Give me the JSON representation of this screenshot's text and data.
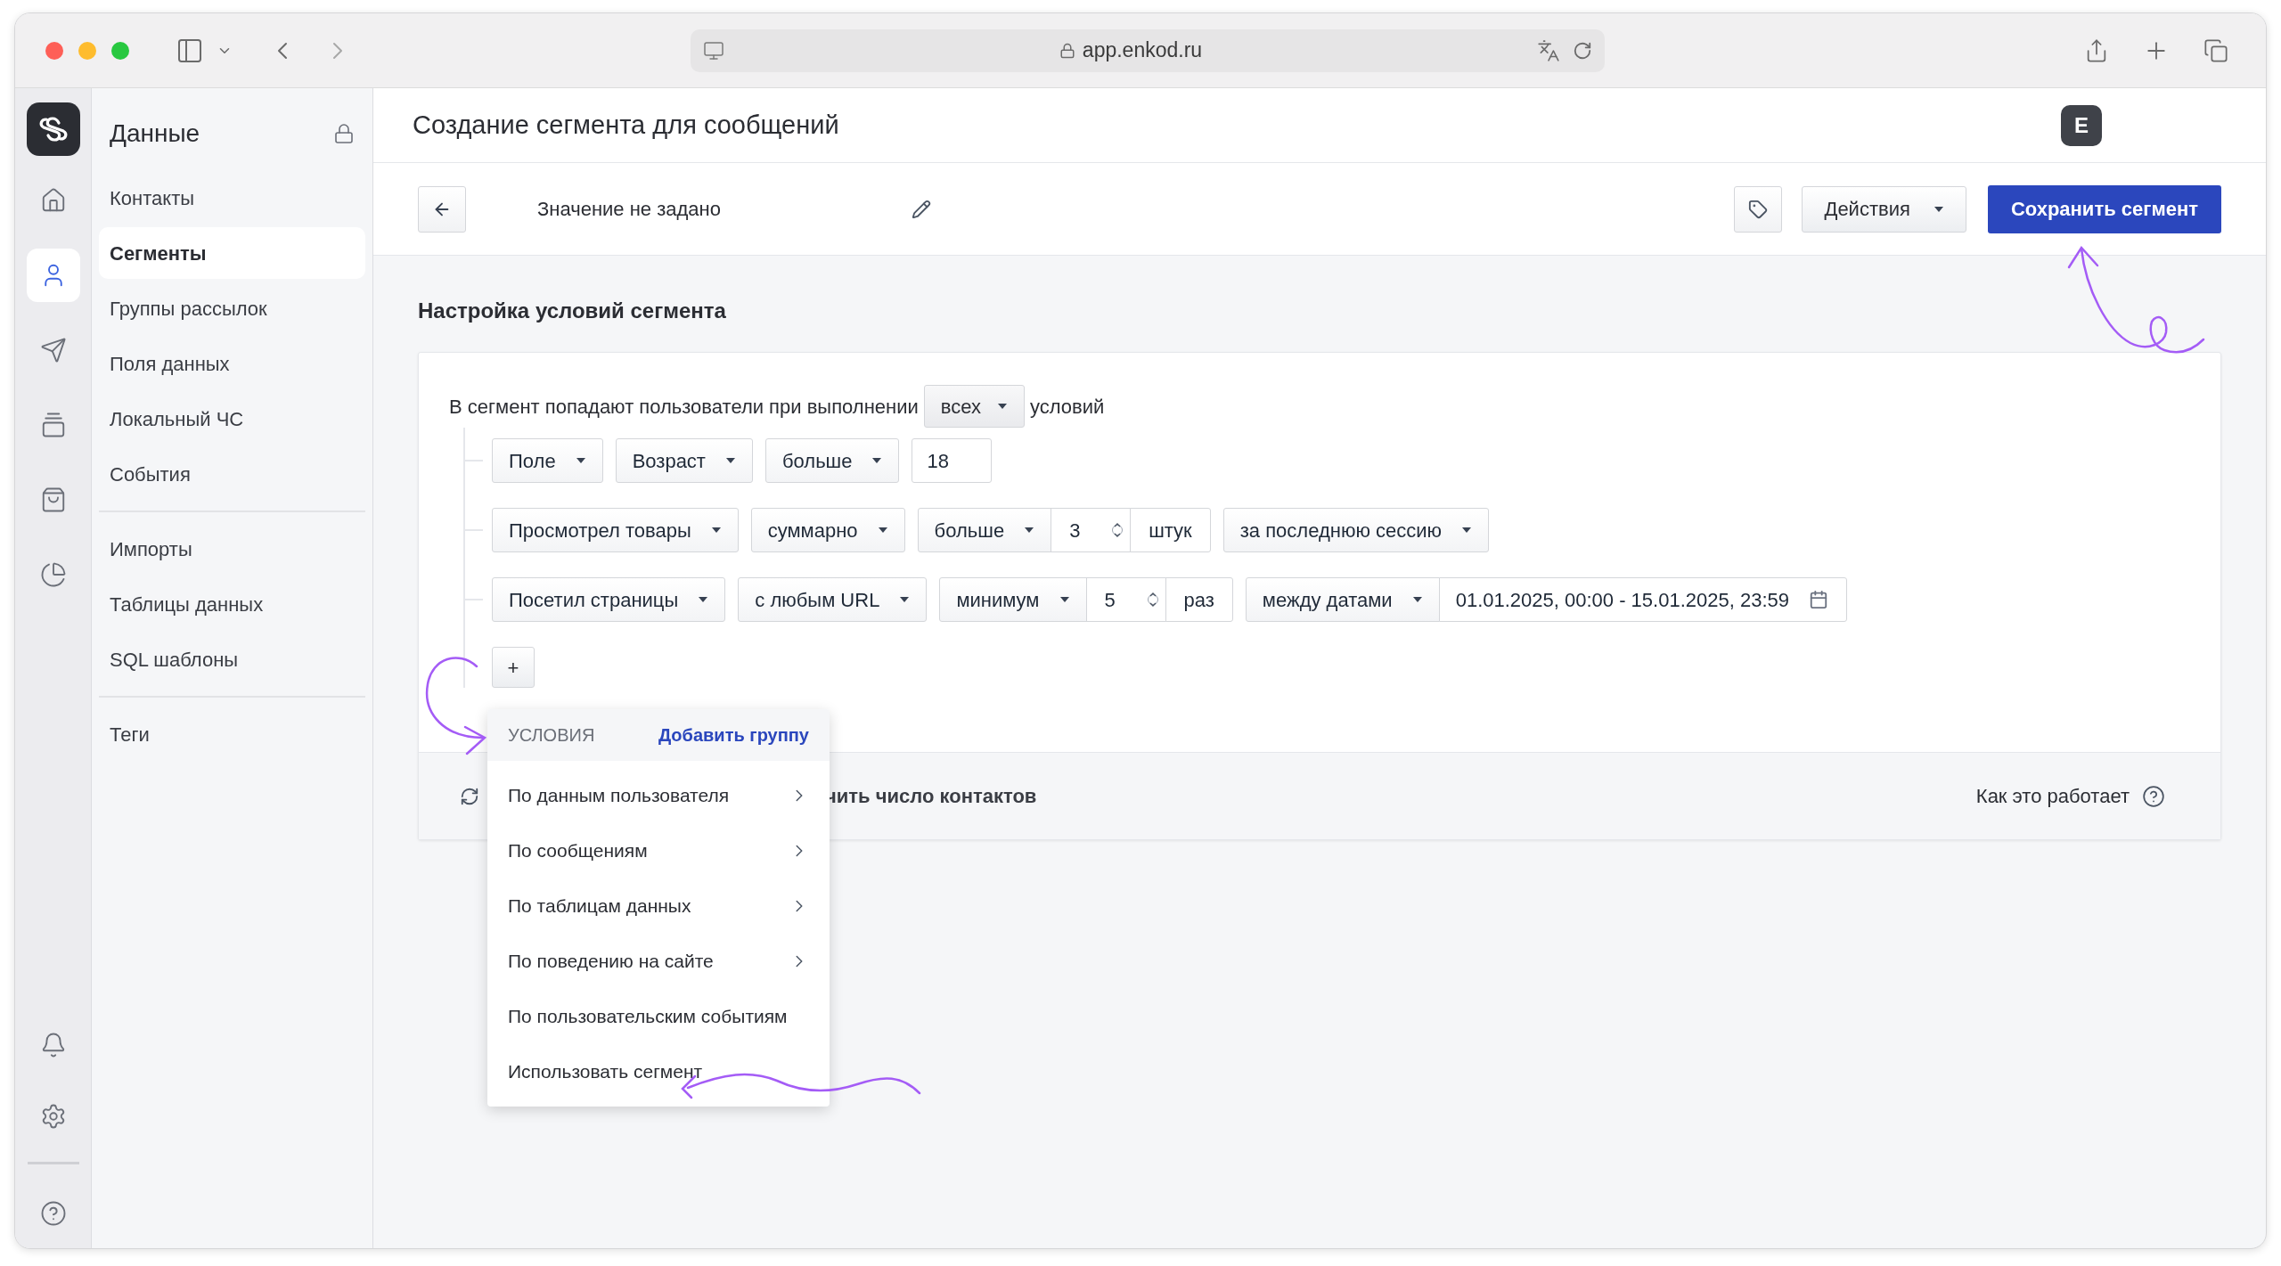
{
  "browser": {
    "url": "app.enkod.ru"
  },
  "rail": {
    "top": [
      {
        "selected": false
      },
      {
        "selected": true
      },
      {
        "selected": false
      },
      {
        "selected": false
      },
      {
        "selected": false
      },
      {
        "selected": false
      }
    ]
  },
  "sidebar": {
    "title": "Данные",
    "groups": [
      {
        "items": [
          {
            "label": "Контакты",
            "selected": false
          },
          {
            "label": "Сегменты",
            "selected": true
          },
          {
            "label": "Группы рассылок",
            "selected": false
          },
          {
            "label": "Поля данных",
            "selected": false
          },
          {
            "label": "Локальный ЧС",
            "selected": false
          },
          {
            "label": "События",
            "selected": false
          }
        ]
      },
      {
        "items": [
          {
            "label": "Импорты",
            "selected": false
          },
          {
            "label": "Таблицы данных",
            "selected": false
          },
          {
            "label": "SQL шаблоны",
            "selected": false
          }
        ]
      },
      {
        "items": [
          {
            "label": "Теги",
            "selected": false
          }
        ]
      }
    ]
  },
  "header": {
    "title": "Создание сегмента для сообщений",
    "avatar": "E"
  },
  "toolbar": {
    "name": "Значение не задано",
    "actions": "Действия",
    "save": "Сохранить сегмент"
  },
  "section_title": "Настройка условий сегмента",
  "rule": {
    "prefix": "В сегмент попадают пользователи при выполнении",
    "match": "всех",
    "suffix": "условий"
  },
  "conditions": [
    {
      "groups": [
        {
          "parts": [
            {
              "kind": "select",
              "value": "Поле"
            }
          ]
        },
        {
          "parts": [
            {
              "kind": "select",
              "value": "Возраст"
            }
          ]
        },
        {
          "parts": [
            {
              "kind": "select",
              "value": "больше"
            }
          ]
        },
        {
          "parts": [
            {
              "kind": "input",
              "value": "18"
            }
          ]
        }
      ]
    },
    {
      "groups": [
        {
          "parts": [
            {
              "kind": "select",
              "value": "Просмотрел товары"
            }
          ]
        },
        {
          "parts": [
            {
              "kind": "select",
              "value": "суммарно"
            }
          ]
        },
        {
          "parts": [
            {
              "kind": "select",
              "value": "больше"
            },
            {
              "kind": "number",
              "value": "3"
            },
            {
              "kind": "unit",
              "value": "штук"
            }
          ]
        },
        {
          "parts": [
            {
              "kind": "select",
              "value": "за последнюю сессию"
            }
          ]
        }
      ]
    },
    {
      "groups": [
        {
          "parts": [
            {
              "kind": "select",
              "value": "Посетил страницы"
            }
          ]
        },
        {
          "parts": [
            {
              "kind": "select",
              "value": "с любым URL"
            }
          ]
        },
        {
          "parts": [
            {
              "kind": "select",
              "value": "минимум"
            },
            {
              "kind": "number",
              "value": "5"
            },
            {
              "kind": "unit",
              "value": "раз"
            }
          ]
        },
        {
          "parts": [
            {
              "kind": "select",
              "value": "между датами"
            },
            {
              "kind": "date",
              "value": "01.01.2025, 00:00 - 15.01.2025, 23:59"
            }
          ]
        }
      ]
    }
  ],
  "add_button": "+",
  "footer": {
    "refresh_label": "чить число контактов",
    "help": "Как это работает"
  },
  "menu": {
    "heading": "УСЛОВИЯ",
    "add_group": "Добавить группу",
    "items": [
      {
        "label": "По данным пользователя",
        "submenu": true
      },
      {
        "label": "По сообщениям",
        "submenu": true
      },
      {
        "label": "По таблицам данных",
        "submenu": true
      },
      {
        "label": "По поведению на сайте",
        "submenu": true
      },
      {
        "label": "По пользовательским событиям",
        "submenu": false
      },
      {
        "label": "Использовать сегмент",
        "submenu": false
      }
    ]
  }
}
